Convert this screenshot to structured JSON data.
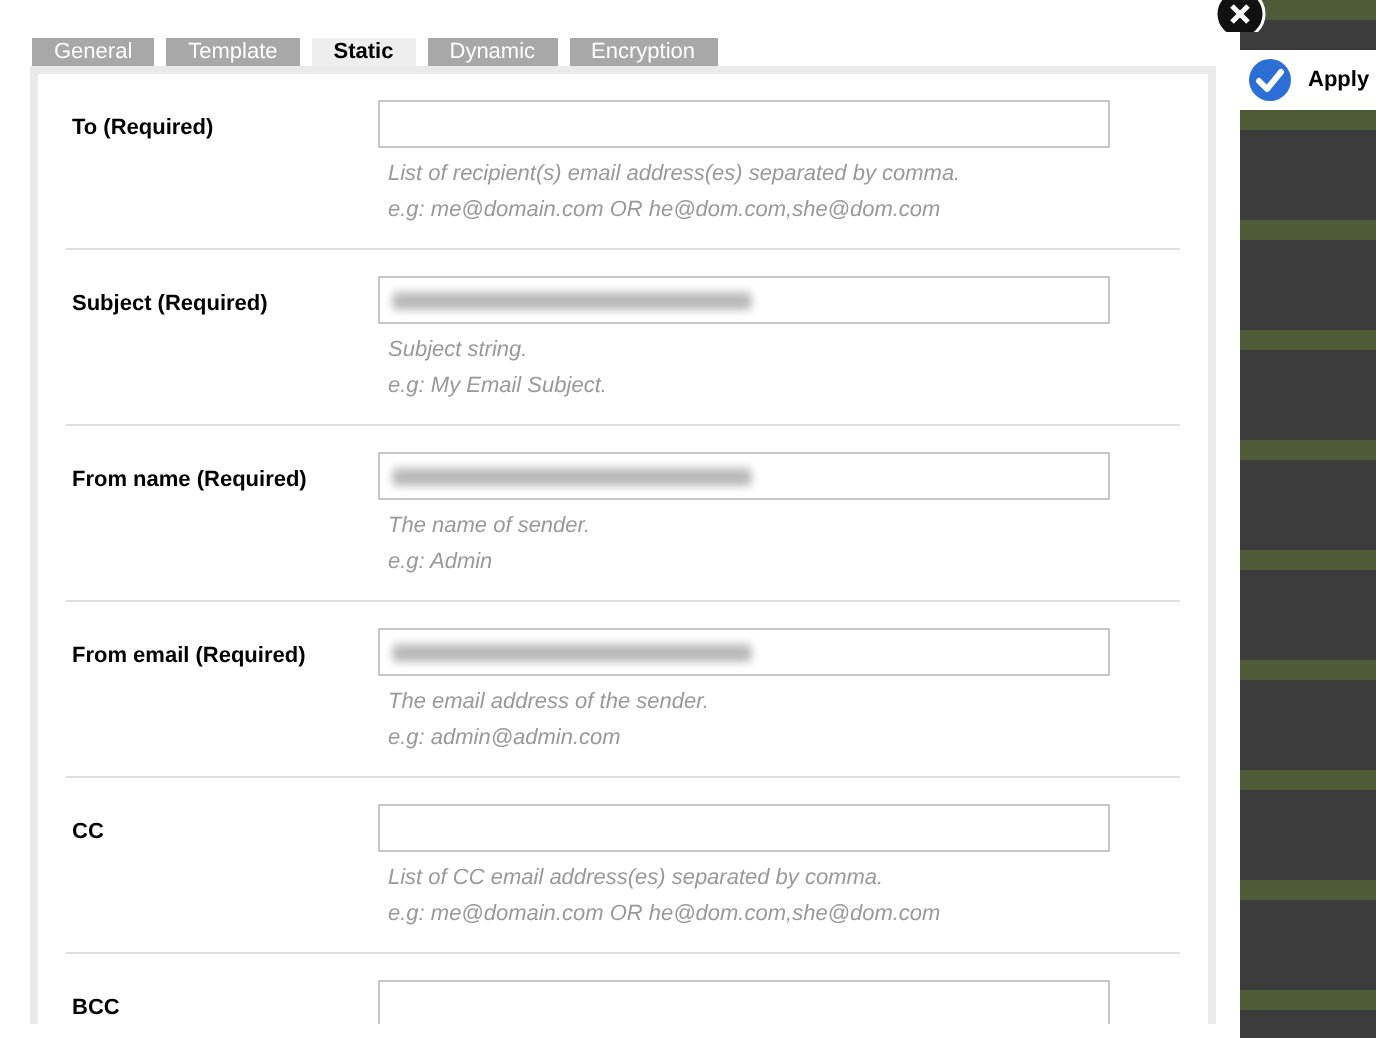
{
  "tabs": [
    {
      "label": "General",
      "selected": false
    },
    {
      "label": "Template",
      "selected": false
    },
    {
      "label": "Static",
      "selected": true
    },
    {
      "label": "Dynamic",
      "selected": false
    },
    {
      "label": "Encryption",
      "selected": false
    }
  ],
  "fields": [
    {
      "label": "To (Required)",
      "blurred": false,
      "hints": [
        "List of recipient(s) email address(es) separated by comma.",
        "e.g: me@domain.com OR he@dom.com,she@dom.com"
      ]
    },
    {
      "label": "Subject (Required)",
      "blurred": true,
      "hints": [
        "Subject string.",
        "e.g: My Email Subject."
      ]
    },
    {
      "label": "From name (Required)",
      "blurred": true,
      "hints": [
        "The name of sender.",
        "e.g: Admin"
      ]
    },
    {
      "label": "From email (Required)",
      "blurred": true,
      "hints": [
        "The email address of the sender.",
        "e.g: admin@admin.com"
      ]
    },
    {
      "label": "CC",
      "blurred": false,
      "hints": [
        "List of CC email address(es) separated by comma.",
        "e.g: me@domain.com OR he@dom.com,she@dom.com"
      ]
    },
    {
      "label": "BCC",
      "blurred": false
    }
  ],
  "apply_button": {
    "label": "Apply"
  }
}
